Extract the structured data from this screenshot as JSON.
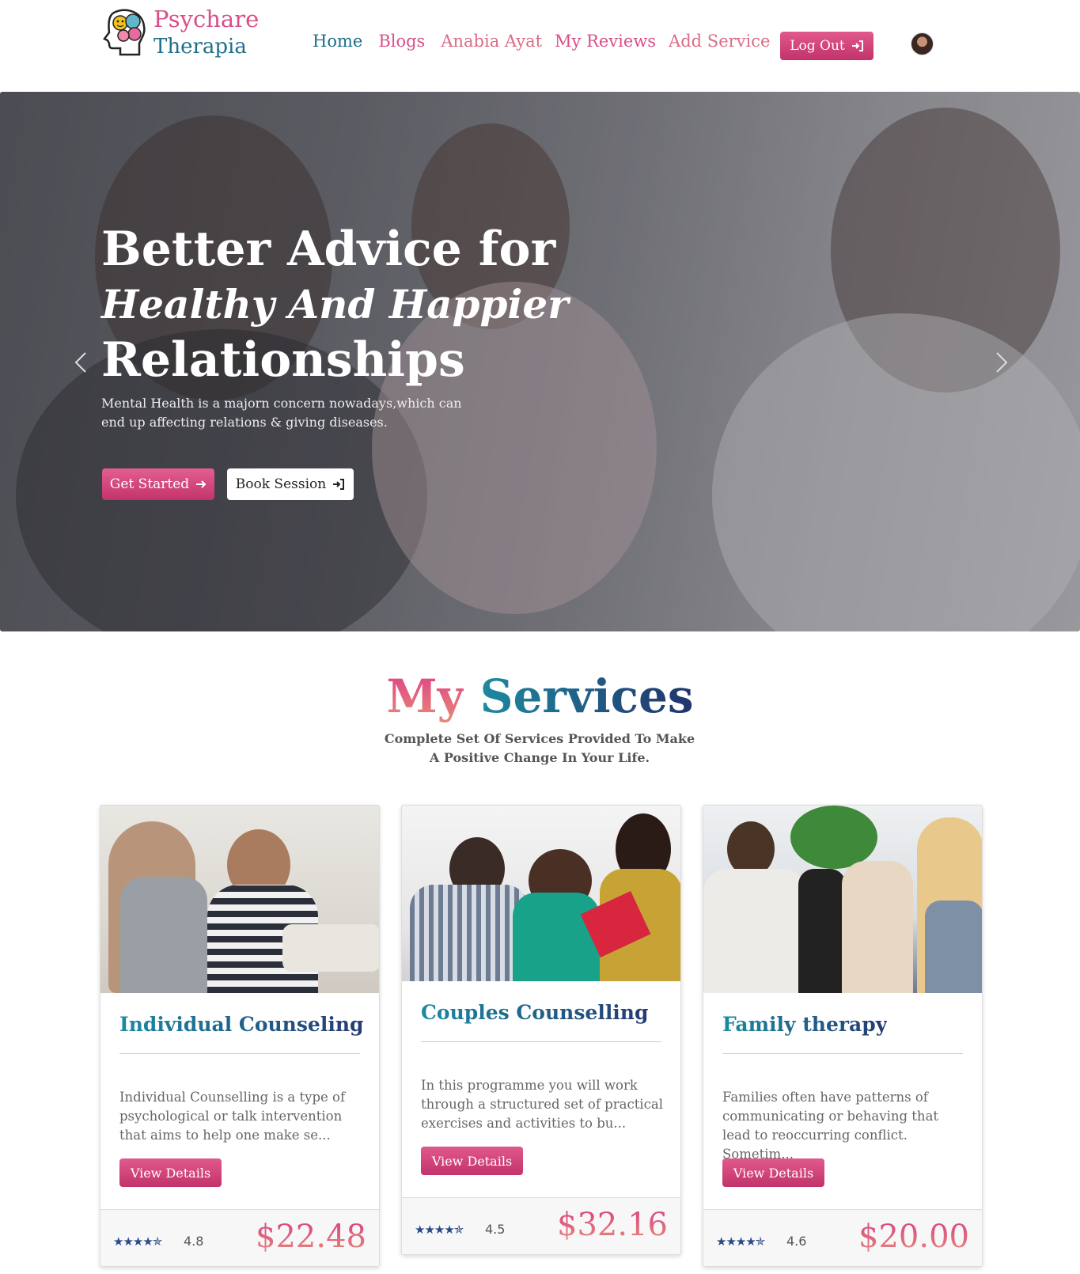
{
  "navbar": {
    "brand_line1": "Psychare",
    "brand_line2": "Therapia",
    "links": [
      "Home",
      "Blogs",
      "Anabia Ayat",
      "My Reviews",
      "Add Service"
    ],
    "logout_label": "Log Out"
  },
  "hero": {
    "title_line1": "Better Advice for",
    "title_line2": "Healthy And Happier",
    "title_line3": "Relationships",
    "description": "Mental Health is a majorn concern nowadays,which can end up affecting relations & giving diseases.",
    "get_started_label": "Get Started",
    "book_session_label": "Book Session"
  },
  "services": {
    "title_my": "My",
    "title_services": "Services",
    "subtitle": "Complete Set Of Services Provided To Make A Positive Change In Your Life.",
    "cards": [
      {
        "title": "Individual Counseling",
        "description": "Individual Counselling is a type of psychological or talk intervention that aims to help one make se...",
        "button": "View Details",
        "stars": "★★★★✯",
        "rating": "4.8",
        "price": "$22.48"
      },
      {
        "title": "Couples Counselling",
        "description": "In this programme you will work through a structured set of practical exercises and activities to bu...",
        "button": "View Details",
        "stars": "★★★★✯",
        "rating": "4.5",
        "price": "$32.16"
      },
      {
        "title": "Family therapy",
        "description": "Families often have patterns of communicating or behaving that lead to reoccurring conflict. Sometim...",
        "button": "View Details",
        "stars": "★★★★✯",
        "rating": "4.6",
        "price": "$20.00"
      }
    ]
  },
  "colors": {
    "accent_pink": "#d94f8a",
    "accent_teal": "#1f6f8b",
    "button_gradient_top": "#e15a8c",
    "button_gradient_bottom": "#c2326b",
    "star_blue": "#2b4a8a"
  }
}
